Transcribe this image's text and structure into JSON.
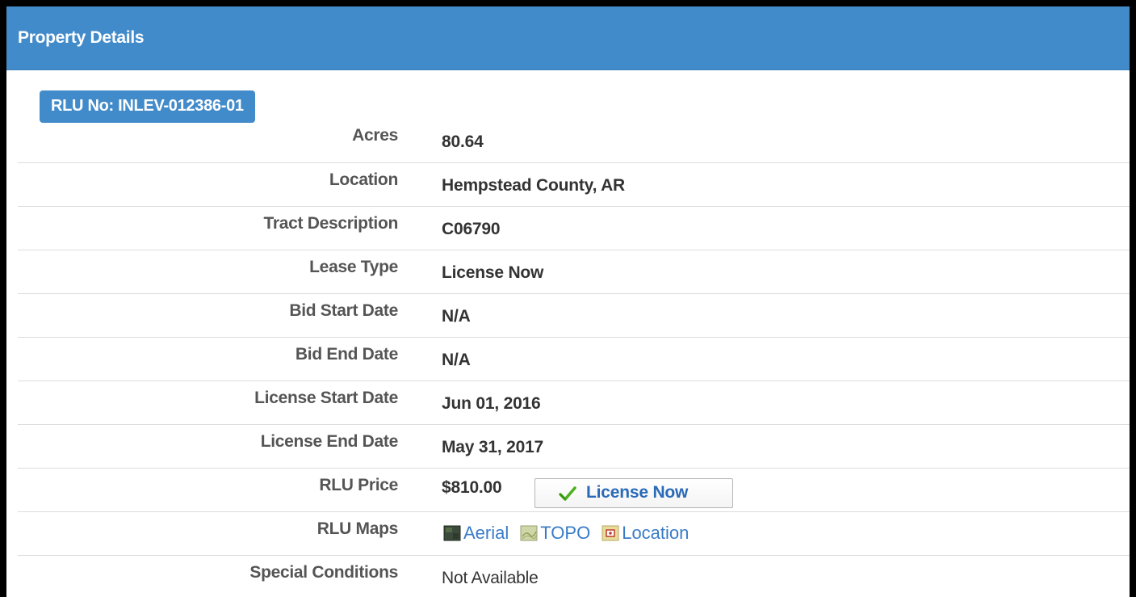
{
  "panel": {
    "title": "Property Details"
  },
  "rlu_badge": "RLU No: INLEV-012386-01",
  "rows": {
    "acres": {
      "label": "Acres",
      "value": "80.64"
    },
    "location": {
      "label": "Location",
      "value": "Hempstead County, AR"
    },
    "tract": {
      "label": "Tract Description",
      "value": "C06790"
    },
    "lease_type": {
      "label": "Lease Type",
      "value": "License Now"
    },
    "bid_start": {
      "label": "Bid Start Date",
      "value": "N/A"
    },
    "bid_end": {
      "label": "Bid End Date",
      "value": "N/A"
    },
    "license_start": {
      "label": "License Start Date",
      "value": "Jun 01, 2016"
    },
    "license_end": {
      "label": "License End Date",
      "value": "May 31, 2017"
    },
    "price": {
      "label": "RLU Price",
      "value": "$810.00",
      "button_label": "License Now"
    },
    "maps": {
      "label": "RLU Maps",
      "links": [
        {
          "text": "Aerial",
          "icon": "aerial-map-icon"
        },
        {
          "text": "TOPO",
          "icon": "topo-map-icon"
        },
        {
          "text": "Location",
          "icon": "location-map-icon"
        }
      ]
    },
    "special": {
      "label": "Special Conditions",
      "value": "Not Available"
    }
  },
  "colors": {
    "header": "#428bca",
    "price": "#1a9a1a",
    "link": "#3a7bc8",
    "label": "#555555"
  }
}
